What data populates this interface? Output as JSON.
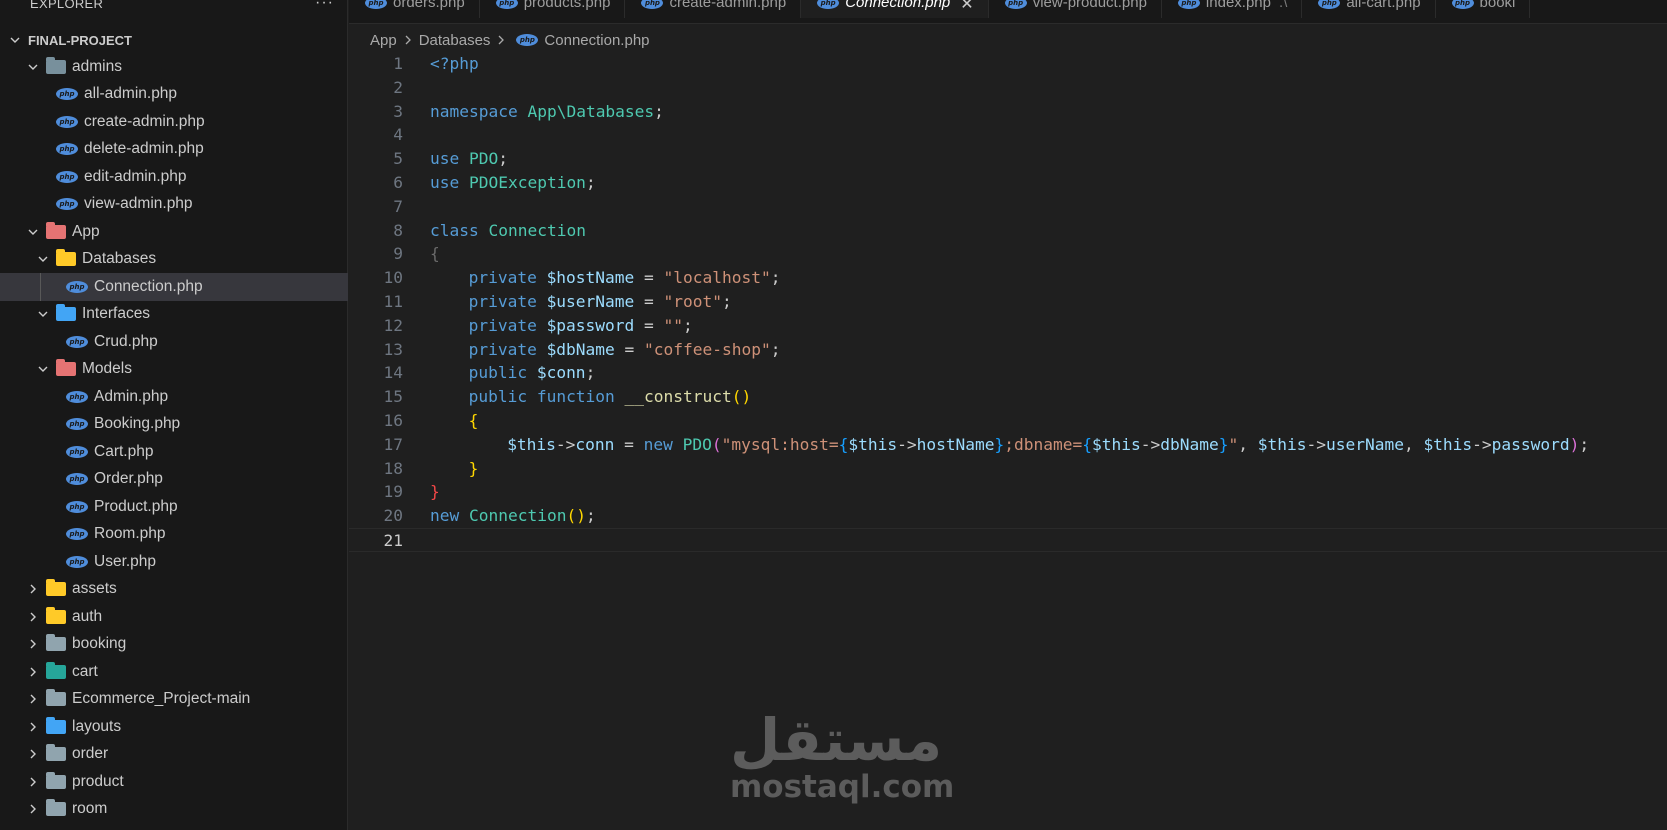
{
  "explorer": {
    "title": "EXPLORER",
    "more": "···",
    "project": "FINAL-PROJECT",
    "tree": [
      {
        "type": "folder",
        "label": "admins",
        "depth": 1,
        "open": true,
        "color": "dark"
      },
      {
        "type": "file",
        "label": "all-admin.php",
        "depth": 2
      },
      {
        "type": "file",
        "label": "create-admin.php",
        "depth": 2
      },
      {
        "type": "file",
        "label": "delete-admin.php",
        "depth": 2
      },
      {
        "type": "file",
        "label": "edit-admin.php",
        "depth": 2
      },
      {
        "type": "file",
        "label": "view-admin.php",
        "depth": 2
      },
      {
        "type": "folder",
        "label": "App",
        "depth": 1,
        "open": true,
        "color": "red"
      },
      {
        "type": "folder",
        "label": "Databases",
        "depth": 2,
        "open": true,
        "color": "yellow"
      },
      {
        "type": "file",
        "label": "Connection.php",
        "depth": 3,
        "active": true
      },
      {
        "type": "folder",
        "label": "Interfaces",
        "depth": 2,
        "open": true,
        "color": "blue"
      },
      {
        "type": "file",
        "label": "Crud.php",
        "depth": 3
      },
      {
        "type": "folder",
        "label": "Models",
        "depth": 2,
        "open": true,
        "color": "red"
      },
      {
        "type": "file",
        "label": "Admin.php",
        "depth": 3
      },
      {
        "type": "file",
        "label": "Booking.php",
        "depth": 3
      },
      {
        "type": "file",
        "label": "Cart.php",
        "depth": 3
      },
      {
        "type": "file",
        "label": "Order.php",
        "depth": 3
      },
      {
        "type": "file",
        "label": "Product.php",
        "depth": 3
      },
      {
        "type": "file",
        "label": "Room.php",
        "depth": 3
      },
      {
        "type": "file",
        "label": "User.php",
        "depth": 3
      },
      {
        "type": "folder",
        "label": "assets",
        "depth": 1,
        "open": false,
        "color": "yellow"
      },
      {
        "type": "folder",
        "label": "auth",
        "depth": 1,
        "open": false,
        "color": "yellow"
      },
      {
        "type": "folder",
        "label": "booking",
        "depth": 1,
        "open": false,
        "color": "grey"
      },
      {
        "type": "folder",
        "label": "cart",
        "depth": 1,
        "open": false,
        "color": "teal"
      },
      {
        "type": "folder",
        "label": "Ecommerce_Project-main",
        "depth": 1,
        "open": false,
        "color": "grey"
      },
      {
        "type": "folder",
        "label": "layouts",
        "depth": 1,
        "open": false,
        "color": "blue"
      },
      {
        "type": "folder",
        "label": "order",
        "depth": 1,
        "open": false,
        "color": "grey"
      },
      {
        "type": "folder",
        "label": "product",
        "depth": 1,
        "open": false,
        "color": "grey"
      },
      {
        "type": "folder",
        "label": "room",
        "depth": 1,
        "open": false,
        "color": "grey"
      }
    ]
  },
  "tabs": [
    {
      "label": "orders.php"
    },
    {
      "label": "products.php"
    },
    {
      "label": "create-admin.php"
    },
    {
      "label": "Connection.php",
      "active": true
    },
    {
      "label": "view-product.php"
    },
    {
      "label": "index.php",
      "suffix": ".\\"
    },
    {
      "label": "all-cart.php"
    },
    {
      "label": "booki"
    }
  ],
  "breadcrumb": [
    "App",
    "Databases",
    "Connection.php"
  ],
  "editor": {
    "current_line": 21,
    "lines": [
      [
        [
          "t-kw",
          "<?php"
        ]
      ],
      [],
      [
        [
          "t-kw",
          "namespace "
        ],
        [
          "t-type",
          "App\\Databases"
        ],
        [
          "t-punct",
          ";"
        ]
      ],
      [],
      [
        [
          "t-kw",
          "use "
        ],
        [
          "t-type",
          "PDO"
        ],
        [
          "t-punct",
          ";"
        ]
      ],
      [
        [
          "t-kw",
          "use "
        ],
        [
          "t-type",
          "PDOException"
        ],
        [
          "t-punct",
          ";"
        ]
      ],
      [],
      [
        [
          "t-kw",
          "class "
        ],
        [
          "t-type",
          "Connection"
        ]
      ],
      [
        [
          "t-dim",
          "{"
        ]
      ],
      [
        [
          "ind",
          "hl"
        ],
        [
          "t-kw",
          "private "
        ],
        [
          "t-var",
          "$hostName"
        ],
        [
          "t-punct",
          " = "
        ],
        [
          "t-str",
          "\"localhost\""
        ],
        [
          "t-punct",
          ";"
        ]
      ],
      [
        [
          "ind",
          "hl"
        ],
        [
          "t-kw",
          "private "
        ],
        [
          "t-var",
          "$userName"
        ],
        [
          "t-punct",
          " = "
        ],
        [
          "t-str",
          "\"root\""
        ],
        [
          "t-punct",
          ";"
        ]
      ],
      [
        [
          "ind",
          "hl"
        ],
        [
          "t-kw",
          "private "
        ],
        [
          "t-var",
          "$password"
        ],
        [
          "t-punct",
          " = "
        ],
        [
          "t-str",
          "\"\""
        ],
        [
          "t-punct",
          ";"
        ]
      ],
      [
        [
          "ind",
          "hl"
        ],
        [
          "t-kw",
          "private "
        ],
        [
          "t-var",
          "$dbName"
        ],
        [
          "t-punct",
          " = "
        ],
        [
          "t-str",
          "\"coffee-shop\""
        ],
        [
          "t-punct",
          ";"
        ]
      ],
      [
        [
          "ind",
          "hl"
        ],
        [
          "t-kw",
          "public "
        ],
        [
          "t-var",
          "$conn"
        ],
        [
          "t-punct",
          ";"
        ]
      ],
      [
        [
          "ind",
          "hl"
        ],
        [
          "t-kw",
          "public "
        ],
        [
          "t-kw",
          "function "
        ],
        [
          "t-fn",
          "__construct"
        ],
        [
          "t-br1",
          "()"
        ]
      ],
      [
        [
          "ind",
          "hl"
        ],
        [
          "t-br1",
          "{"
        ]
      ],
      [
        [
          "ind",
          "hl"
        ],
        [
          "ind",
          "hl2"
        ],
        [
          "t-var",
          "$this"
        ],
        [
          "t-punct",
          "->"
        ],
        [
          "t-var",
          "conn"
        ],
        [
          "t-punct",
          " = "
        ],
        [
          "t-kw",
          "new "
        ],
        [
          "t-type",
          "PDO"
        ],
        [
          "t-br2",
          "("
        ],
        [
          "t-str",
          "\"mysql:host="
        ],
        [
          "t-br3",
          "{"
        ],
        [
          "t-var",
          "$this"
        ],
        [
          "t-punct",
          "->"
        ],
        [
          "t-var",
          "hostName"
        ],
        [
          "t-br3",
          "}"
        ],
        [
          "t-str",
          ";dbname="
        ],
        [
          "t-br3",
          "{"
        ],
        [
          "t-var",
          "$this"
        ],
        [
          "t-punct",
          "->"
        ],
        [
          "t-var",
          "dbName"
        ],
        [
          "t-br3",
          "}"
        ],
        [
          "t-str",
          "\""
        ],
        [
          "t-punct",
          ", "
        ],
        [
          "t-var",
          "$this"
        ],
        [
          "t-punct",
          "->"
        ],
        [
          "t-var",
          "userName"
        ],
        [
          "t-punct",
          ", "
        ],
        [
          "t-var",
          "$this"
        ],
        [
          "t-punct",
          "->"
        ],
        [
          "t-var",
          "password"
        ],
        [
          "t-br2",
          ")"
        ],
        [
          "t-punct",
          ";"
        ]
      ],
      [
        [
          "ind",
          "hl"
        ],
        [
          "t-br1",
          "}"
        ]
      ],
      [
        [
          "t-red",
          "}"
        ]
      ],
      [
        [
          "t-kw",
          "new "
        ],
        [
          "t-type",
          "Connection"
        ],
        [
          "t-br1",
          "()"
        ],
        [
          "t-punct",
          ";"
        ]
      ],
      []
    ]
  },
  "watermark": {
    "arabic": "مستقل",
    "latin": "mostaql.com"
  }
}
